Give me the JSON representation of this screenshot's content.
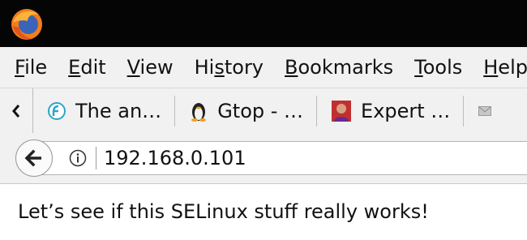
{
  "menubar": {
    "items": [
      {
        "key": "F",
        "rest": "ile"
      },
      {
        "key": "E",
        "rest": "dit"
      },
      {
        "key": "V",
        "rest": "iew"
      },
      {
        "pre": "Hi",
        "key": "s",
        "rest": "tory"
      },
      {
        "key": "B",
        "rest": "ookmarks"
      },
      {
        "key": "T",
        "rest": "ools"
      },
      {
        "key": "H",
        "rest": "elp"
      }
    ]
  },
  "bookmarks": {
    "items": [
      {
        "label": "The an…"
      },
      {
        "label": "Gtop - …"
      },
      {
        "label": "Expert …"
      }
    ]
  },
  "address_bar": {
    "url": "192.168.0.101"
  },
  "page": {
    "text": "Let’s see if this SELinux stuff really works!"
  }
}
